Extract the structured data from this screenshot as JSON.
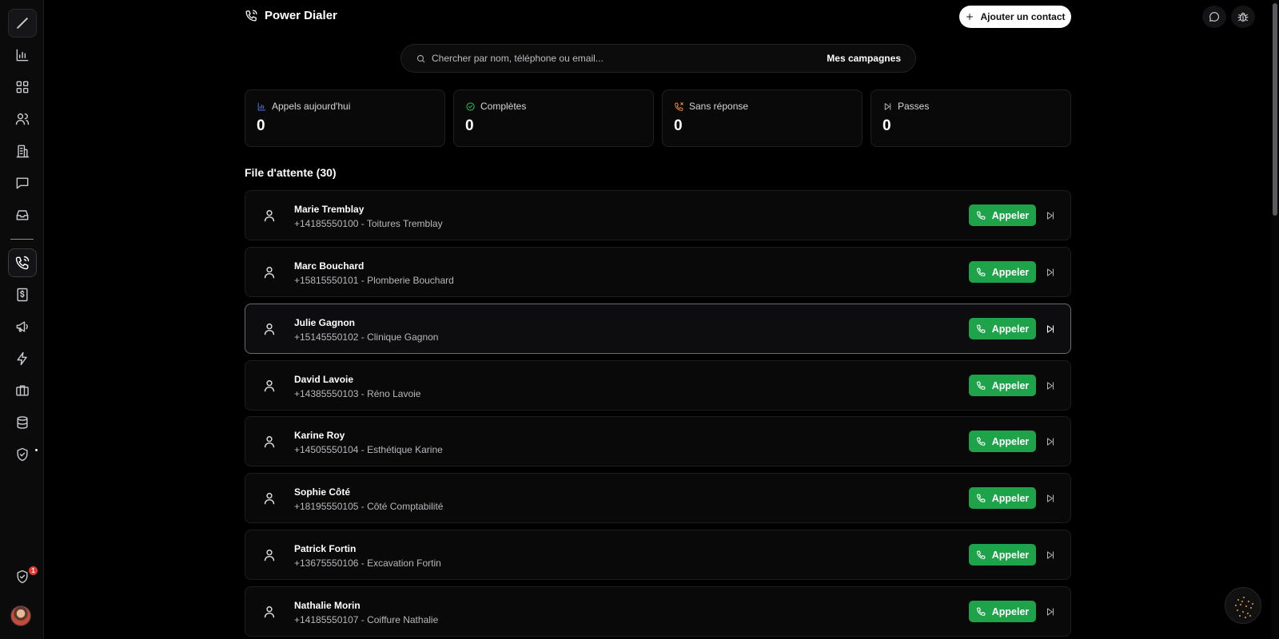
{
  "app": {
    "title": "Power Dialer"
  },
  "header": {
    "add_contact_label": "Ajouter un contact"
  },
  "search": {
    "placeholder": "Chercher par nom, téléphone ou email...",
    "campaigns_label": "Mes campagnes"
  },
  "stats": [
    {
      "label": "Appels aujourd'hui",
      "value": "0",
      "icon": "bar-chart-icon",
      "color": "#4f7bdc"
    },
    {
      "label": "Complètes",
      "value": "0",
      "icon": "check-circle-icon",
      "color": "#22c55e"
    },
    {
      "label": "Sans réponse",
      "value": "0",
      "icon": "phone-missed-icon",
      "color": "#f08a3c"
    },
    {
      "label": "Passes",
      "value": "0",
      "icon": "skip-icon",
      "color": "#b5b5ba"
    }
  ],
  "queue": {
    "title": "File d'attente (30)",
    "call_label": "Appeler",
    "contacts": [
      {
        "name": "Marie Tremblay",
        "detail": "+14185550100 - Toitures Tremblay"
      },
      {
        "name": "Marc Bouchard",
        "detail": "+15815550101 - Plomberie Bouchard"
      },
      {
        "name": "Julie Gagnon",
        "detail": "+15145550102 - Clinique Gagnon"
      },
      {
        "name": "David Lavoie",
        "detail": "+14385550103 - Réno Lavoie"
      },
      {
        "name": "Karine Roy",
        "detail": "+14505550104 - Esthétique Karine"
      },
      {
        "name": "Sophie Côté",
        "detail": "+18195550105 - Côté Comptabilité"
      },
      {
        "name": "Patrick Fortin",
        "detail": "+13675550106 - Excavation Fortin"
      },
      {
        "name": "Nathalie Morin",
        "detail": "+14185550107 - Coiffure Nathalie"
      }
    ]
  },
  "sidebar": {
    "notification_count": "1",
    "items": [
      "logo-icon",
      "analytics-icon",
      "dashboard-icon",
      "contacts-icon",
      "companies-icon",
      "messages-icon",
      "inbox-icon",
      "phone-icon",
      "invoices-icon",
      "campaigns-icon",
      "automations-icon",
      "jobs-icon",
      "database-icon",
      "security-icon",
      "shield-alert-icon",
      "user-avatar"
    ]
  },
  "colors": {
    "accent_green": "#1fa34a",
    "background": "#000000"
  }
}
